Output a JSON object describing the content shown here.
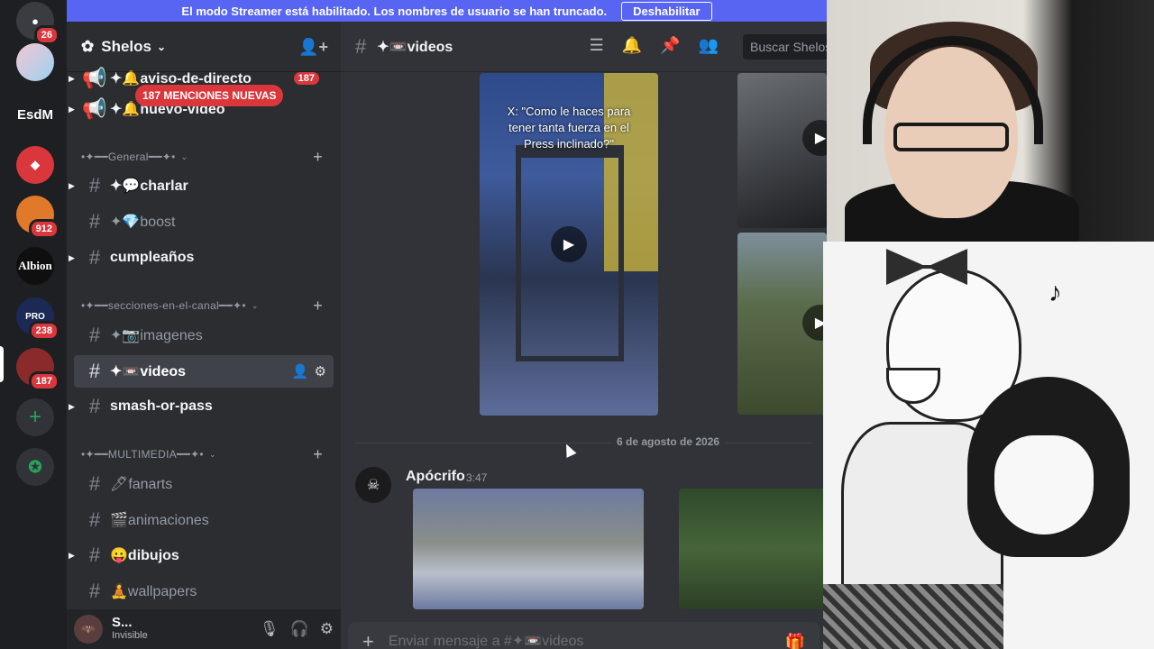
{
  "streamer_banner": {
    "message": "El modo Streamer está habilitado. Los nombres de usuario se han truncado.",
    "button": "Deshabilitar"
  },
  "servers": [
    {
      "label": "",
      "badge": "26"
    },
    {
      "label": "",
      "badge": ""
    },
    {
      "label": "EsdM",
      "badge": ""
    },
    {
      "label": "",
      "badge": ""
    },
    {
      "label": "",
      "badge": "912"
    },
    {
      "label": "Albion",
      "badge": ""
    },
    {
      "label": "PRO",
      "badge": "238"
    },
    {
      "label": "",
      "badge": "187"
    }
  ],
  "guild": {
    "name": "Shelos"
  },
  "mentions_pill": "187 MENCIONES NUEVAS",
  "sidebar": {
    "channels": [
      {
        "name": "✦🔔aviso-de-directo",
        "badge": "187"
      },
      {
        "name": "✦🔔nuevo-video"
      },
      {
        "category": "•✦━━General━━✦•"
      },
      {
        "name": "✦💬charlar"
      },
      {
        "name": "✦💎boost"
      },
      {
        "name": "cumpleaños"
      },
      {
        "category": "•✦━━secciones-en-el-canal━━✦•"
      },
      {
        "name": "✦📷imagenes"
      },
      {
        "name": "✦📼videos"
      },
      {
        "name": "smash-or-pass"
      },
      {
        "category": "•✦━━MULTIMEDIA━━✦•"
      },
      {
        "name": "🖊fanarts"
      },
      {
        "name": "🎬animaciones"
      },
      {
        "name": "😛dibujos"
      },
      {
        "name": "🧘wallpapers"
      }
    ]
  },
  "user_panel": {
    "name": "S...",
    "status": "Invisible"
  },
  "chat": {
    "channel_name": "✦📼videos",
    "search_placeholder": "Buscar Shelos",
    "video1_caption": "X: \"Como le haces para tener tanta fuerza en el Press inclinado?\"",
    "date_divider": "6 de agosto de 2026",
    "message": {
      "author": "Apócrifo",
      "time": "3:47"
    },
    "composer_placeholder": "Enviar mensaje a #✦📼videos"
  },
  "icons": {
    "threads": "threads-icon",
    "bell": "bell-icon",
    "pin": "pin-icon",
    "members": "members-icon",
    "invite": "add-member-icon",
    "gift": "gift-icon",
    "mic": "microphone-icon",
    "headphones": "headphones-icon",
    "settings": "gear-icon"
  },
  "colors": {
    "accent": "#5865f2",
    "danger": "#da373c"
  }
}
